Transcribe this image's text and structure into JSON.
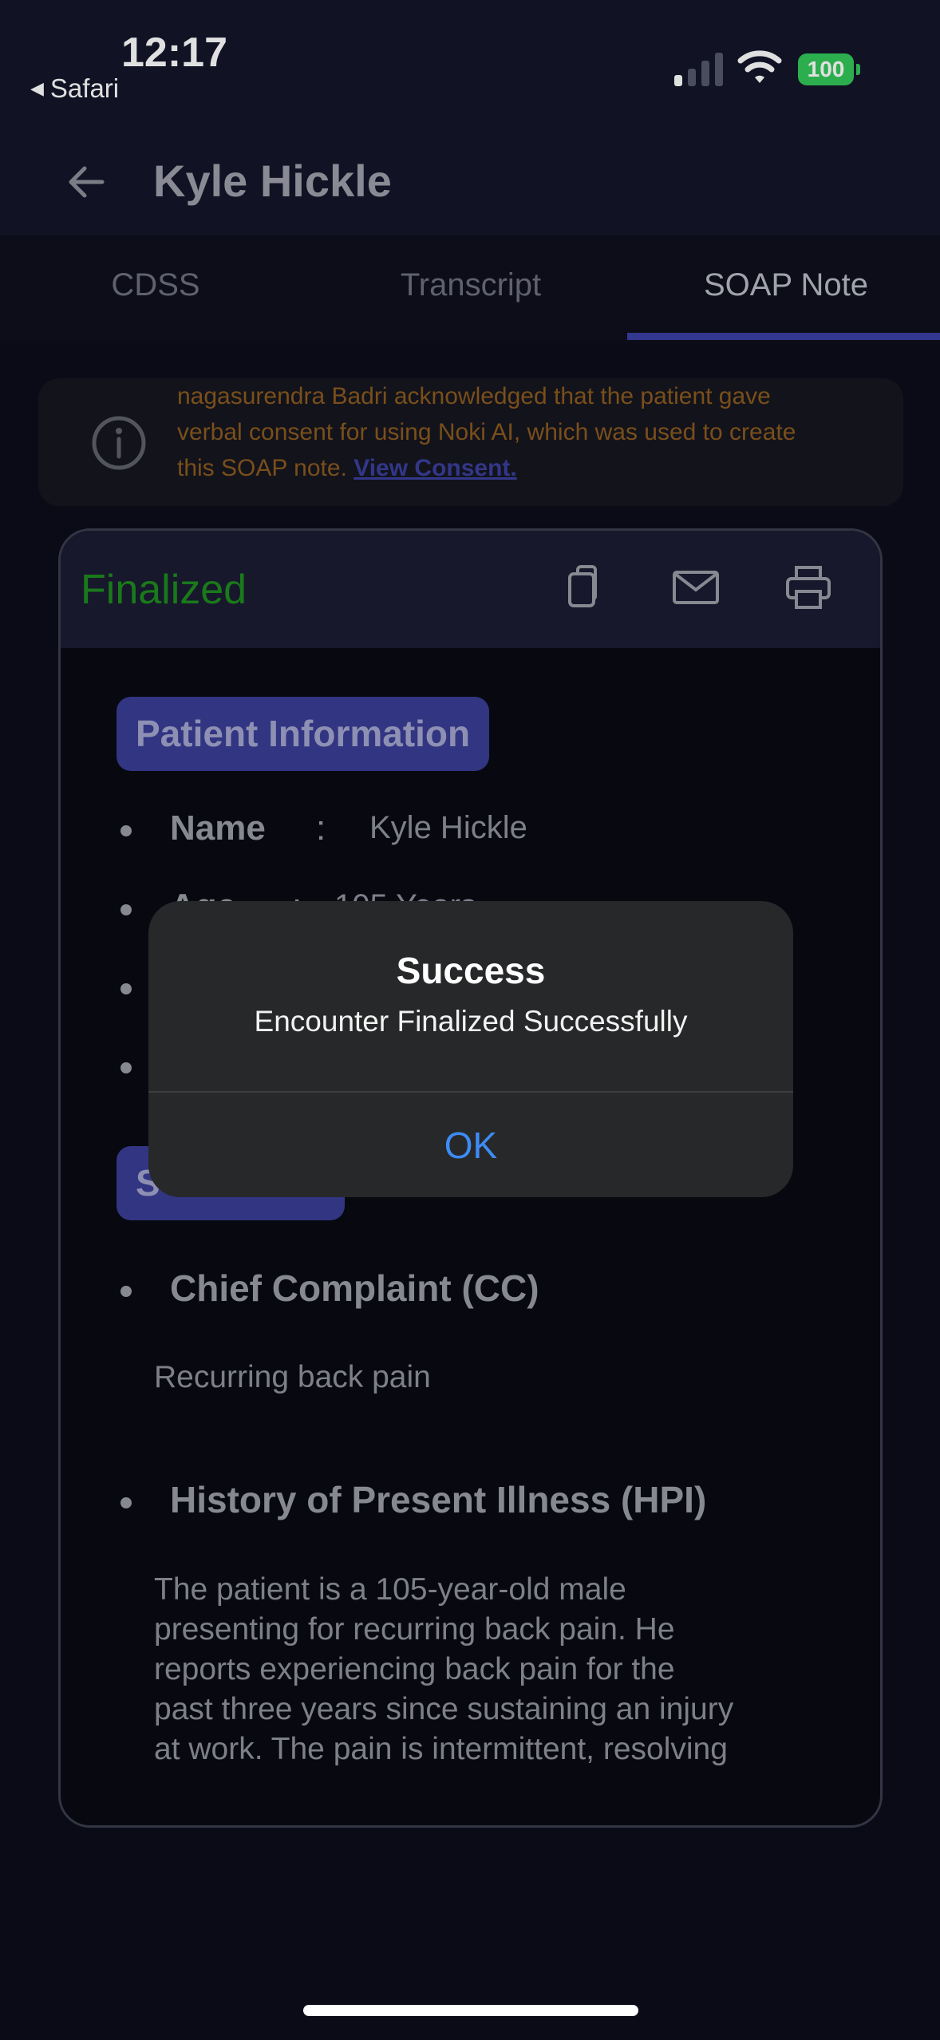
{
  "status_bar": {
    "time": "12:17",
    "back_app": "Safari",
    "battery": "100"
  },
  "header": {
    "title": "Kyle Hickle"
  },
  "tabs": [
    {
      "label": "CDSS"
    },
    {
      "label": "Transcript"
    },
    {
      "label": "SOAP Note",
      "active": true
    }
  ],
  "consent": {
    "lines": [
      "nagasurendra Badri acknowledged that the patient gave",
      "verbal consent for using Noki AI, which was used to create",
      "this SOAP note. "
    ],
    "link": "View Consent."
  },
  "card": {
    "status": "Finalized",
    "patient_info": {
      "heading": "Patient Information",
      "fields": [
        {
          "label": "Name",
          "sep": ":",
          "value": "Kyle Hickle"
        },
        {
          "label": "Age",
          "sep": ":",
          "value": "105 Years"
        }
      ]
    },
    "subjective_heading_partial": "S",
    "sections": [
      {
        "title": "Chief Complaint (CC)",
        "lines": [
          "Recurring back pain"
        ]
      },
      {
        "title": "History of Present Illness (HPI)",
        "lines": [
          "The patient is a 105-year-old male",
          "presenting for recurring back pain. He",
          "reports experiencing back pain for the",
          "past three years since sustaining an injury",
          "at work. The pain is intermittent, resolving"
        ]
      }
    ]
  },
  "alert": {
    "title": "Success",
    "message": "Encounter Finalized Successfully",
    "ok": "OK"
  },
  "colors": {
    "background": "#0c0d1a",
    "accent": "#3b3fa3",
    "finalized": "#1e8a1e",
    "consent_text": "#8a5b1f",
    "alert_button": "#3d8cf5"
  }
}
